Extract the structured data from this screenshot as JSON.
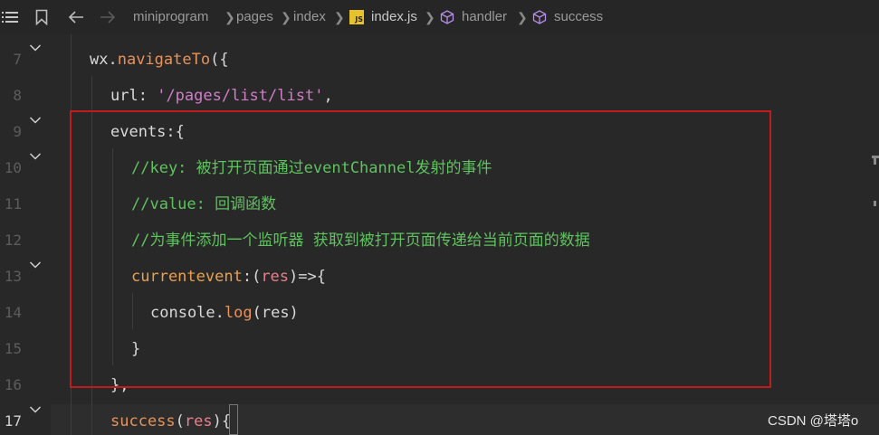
{
  "breadcrumb": {
    "items": [
      "miniprogram",
      "pages",
      "index",
      "index.js",
      "handler",
      "success"
    ],
    "file_badge": "JS"
  },
  "gutter": {
    "line_numbers": [
      "7",
      "8",
      "9",
      "10",
      "11",
      "12",
      "13",
      "14",
      "15",
      "16",
      "17"
    ],
    "active_line": "17"
  },
  "code": {
    "l7": {
      "obj": "wx.",
      "fn": "navigateTo",
      "tail": "({"
    },
    "l8": {
      "key": "url",
      "colon": ": ",
      "str": "'/pages/list/list'",
      "tail": ","
    },
    "l9": {
      "key": "events",
      "tail": ":{"
    },
    "l10": "//key: 被打开页面通过eventChannel发射的事件",
    "l11": "//value: 回调函数",
    "l12": "//为事件添加一个监听器 获取到被打开页面传递给当前页面的数据",
    "l13": {
      "key": "currentevent",
      "colon": ":(",
      "param": "res",
      "tail": ")=>{"
    },
    "l14": {
      "obj": "console.",
      "fn": "log",
      "tail": "(res)"
    },
    "l15": "}",
    "l16": "},",
    "l17": {
      "fn": "success",
      "open": "(",
      "param": "res",
      "tail": "){"
    }
  },
  "watermark": "CSDN @塔塔o",
  "colors": {
    "background": "#282828",
    "comment": "#5ec25e",
    "function": "#e8925a",
    "string": "#d07dc7",
    "highlight_box": "#c01c1c"
  }
}
